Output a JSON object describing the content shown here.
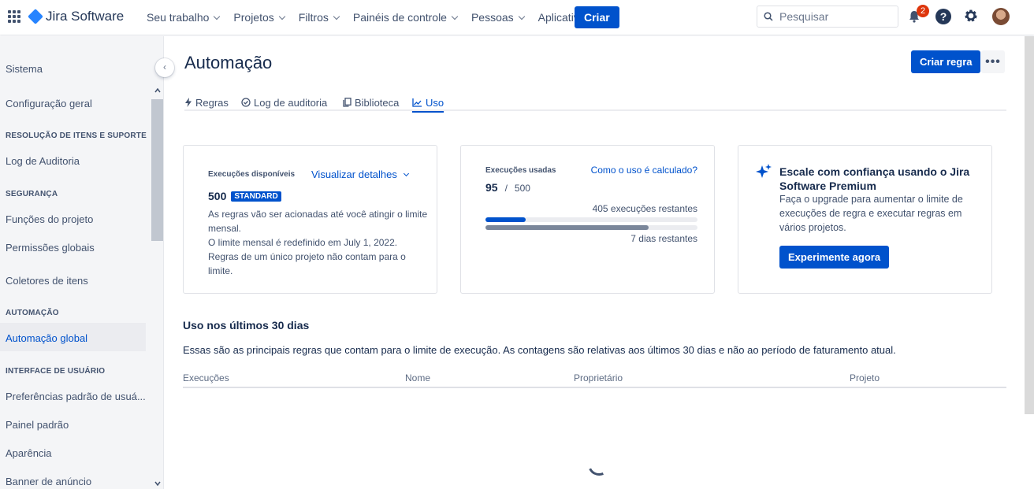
{
  "topnav": {
    "logo_text": "Jira Software",
    "menu": [
      {
        "label": "Seu trabalho"
      },
      {
        "label": "Projetos"
      },
      {
        "label": "Filtros"
      },
      {
        "label": "Painéis de controle"
      },
      {
        "label": "Pessoas"
      },
      {
        "label": "Aplicativos"
      }
    ],
    "create_label": "Criar",
    "search_placeholder": "Pesquisar",
    "notification_count": "2",
    "help_glyph": "?"
  },
  "sidebar": {
    "items": [
      {
        "type": "item",
        "label": "Sistema"
      },
      {
        "type": "item",
        "label": "Configuração geral"
      },
      {
        "type": "header",
        "label": "RESOLUÇÃO DE ITENS E SUPORTE"
      },
      {
        "type": "item",
        "label": "Log de Auditoria"
      },
      {
        "type": "header",
        "label": "SEGURANÇA"
      },
      {
        "type": "item",
        "label": "Funções do projeto"
      },
      {
        "type": "item",
        "label": "Permissões globais"
      },
      {
        "type": "item",
        "label": "Coletores de itens"
      },
      {
        "type": "header",
        "label": "AUTOMAÇÃO"
      },
      {
        "type": "item",
        "label": "Automação global",
        "active": true
      },
      {
        "type": "header",
        "label": "INTERFACE DE USUÁRIO"
      },
      {
        "type": "item",
        "label": "Preferências padrão de usuá..."
      },
      {
        "type": "item",
        "label": "Painel padrão"
      },
      {
        "type": "item",
        "label": "Aparência"
      },
      {
        "type": "item",
        "label": "Banner de anúncio"
      }
    ]
  },
  "page": {
    "title": "Automação",
    "create_rule_label": "Criar regra",
    "more_label": "•••",
    "tabs": [
      {
        "label": "Regras",
        "icon": "bolt-icon"
      },
      {
        "label": "Log de auditoria",
        "icon": "check-circle-icon"
      },
      {
        "label": "Biblioteca",
        "icon": "copy-icon"
      },
      {
        "label": "Uso",
        "icon": "chart-icon",
        "active": true
      }
    ]
  },
  "cards": {
    "available": {
      "label": "Execuções disponíveis",
      "link": "Visualizar detalhes",
      "value": "500",
      "badge": "STANDARD",
      "lines": [
        "As regras vão ser acionadas até você atingir o limite",
        "mensal.",
        "O limite mensal é redefinido em July 1, 2022.",
        "Regras de um único projeto não contam para o",
        "limite."
      ]
    },
    "used": {
      "label": "Execuções usadas",
      "link": "Como o uso é calculado?",
      "used": "95",
      "separator": "/",
      "total": "500",
      "remaining": "405 execuções restantes",
      "days_remaining": "7 dias restantes",
      "executions_fraction": 0.19,
      "days_fraction": 0.77
    },
    "premium": {
      "title": "Escale com confiança usando o Jira Software Premium",
      "description": "Faça o upgrade para aumentar o limite de execuções de regra e executar regras em vários projetos.",
      "button": "Experimente agora"
    }
  },
  "usage": {
    "title": "Uso nos últimos 30 dias",
    "description": "Essas são as principais regras que contam para o limite de execução. As contagens são relativas aos últimos 30 dias e não ao período de faturamento atual.",
    "columns": [
      "Execuções",
      "Nome",
      "Proprietário",
      "Projeto"
    ]
  },
  "colors": {
    "primary": "#0052cc",
    "text": "#172b4d",
    "subtle": "#42526e",
    "badge_red": "#de350b",
    "bar_track": "#ebecf0",
    "bar_days": "#7a869a"
  }
}
